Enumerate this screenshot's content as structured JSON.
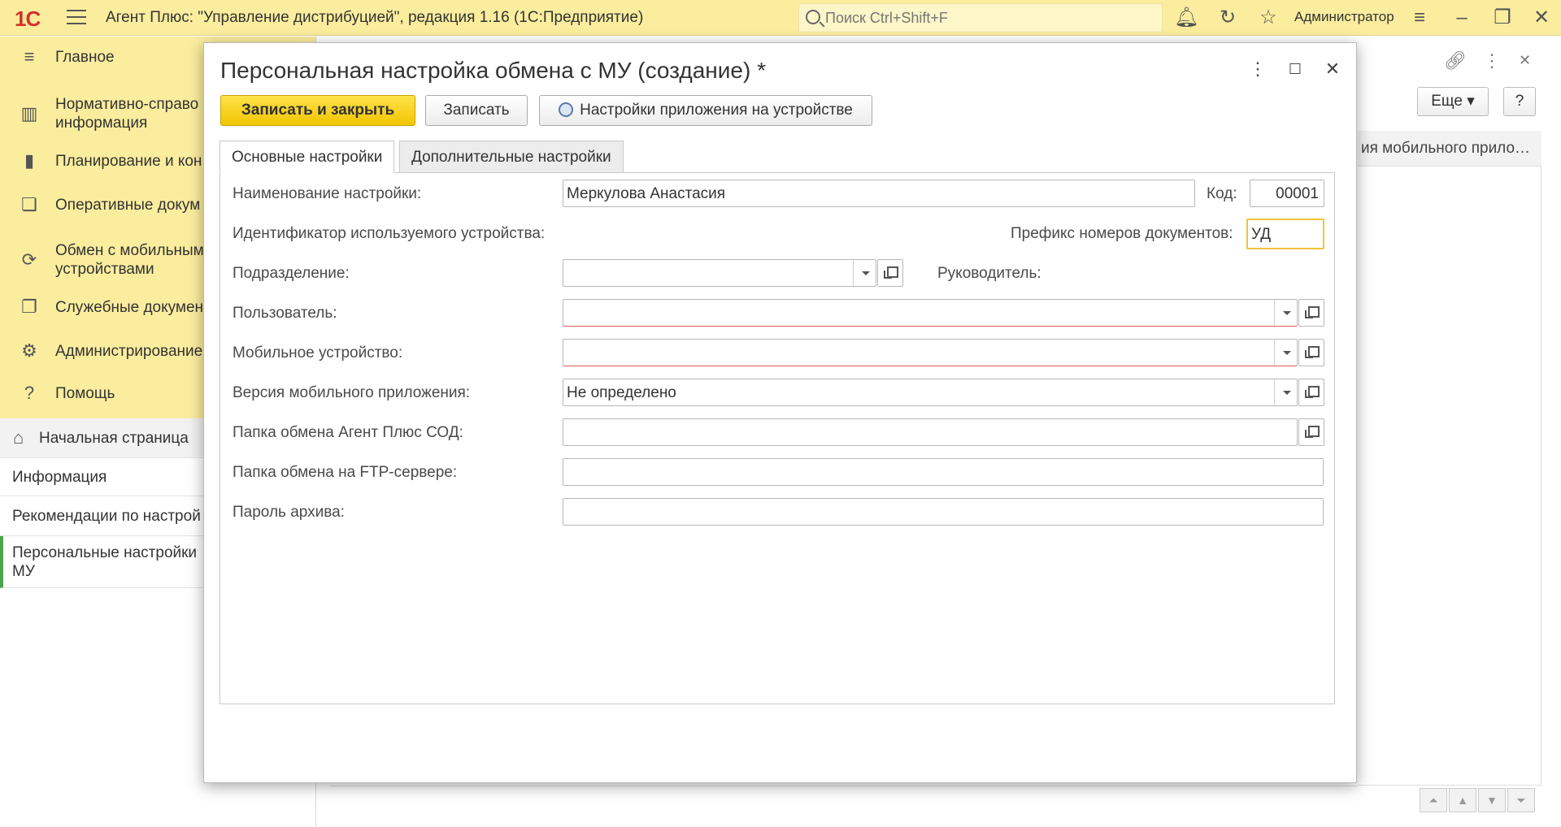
{
  "topbar": {
    "logo": "1С",
    "app_title": "Агент Плюс: \"Управление дистрибуцией\", редакция 1.16  (1С:Предприятие)",
    "search_placeholder": "Поиск Ctrl+Shift+F",
    "user": "Администратор"
  },
  "sidebar": {
    "items": [
      {
        "label": "Главное",
        "icon": "menu-lines-icon"
      },
      {
        "label": "Нормативно-справочная информация",
        "label_line1": "Нормативно-справо",
        "label_line2": "информация",
        "icon": "reference-icon"
      },
      {
        "label": "Планирование и контроль",
        "label_line1": "Планирование и кон",
        "icon": "bar-chart-icon"
      },
      {
        "label": "Оперативные документы",
        "label_line1": "Оперативные докум",
        "icon": "documents-icon"
      },
      {
        "label": "Обмен с мобильными устройствами",
        "label_line1": "Обмен с мобильным",
        "label_line2": "устройствами",
        "icon": "sync-icon"
      },
      {
        "label": "Служебные документы",
        "label_line1": "Служебные докумен",
        "icon": "service-docs-icon"
      },
      {
        "label": "Администрирование",
        "label_line1": "Администрирование",
        "icon": "gear-icon"
      },
      {
        "label": "Помощь",
        "icon": "question-icon"
      }
    ]
  },
  "lower_nav": {
    "items": [
      {
        "label": "Начальная страница",
        "icon": "home-icon"
      },
      {
        "label": "Информация"
      },
      {
        "label": "Рекомендации по настройке",
        "label_line1": "Рекомендации по настрой"
      },
      {
        "label_line1": "Персональные настройки",
        "label_line2": "МУ"
      }
    ]
  },
  "background": {
    "more_label": "Еще",
    "help_label": "?",
    "column_header": "ия мобильного прило…"
  },
  "modal": {
    "title": "Персональная настройка обмена с МУ (создание) *",
    "buttons": {
      "save_close": "Записать и закрыть",
      "save": "Записать",
      "app_settings": "Настройки приложения на устройстве"
    },
    "tabs": [
      "Основные настройки",
      "Дополнительные настройки"
    ],
    "fields": {
      "name_label": "Наименование настройки:",
      "name_value": "Меркулова Анастасия",
      "code_label": "Код:",
      "code_value": "00001",
      "device_id_label": "Идентификатор используемого устройства:",
      "prefix_label": "Префикс номеров документов:",
      "prefix_value": "УД",
      "division_label": "Подразделение:",
      "division_value": "",
      "manager_label": "Руководитель:",
      "user_label": "Пользователь:",
      "user_value": "",
      "mobile_device_label": "Мобильное устройство:",
      "mobile_device_value": "",
      "app_version_label": "Версия мобильного приложения:",
      "app_version_value": "Не определено",
      "folder_label": "Папка обмена Агент Плюс СОД:",
      "folder_value": "",
      "ftp_label": "Папка обмена на FTP-сервере:",
      "ftp_value": "",
      "password_label": "Пароль архива:",
      "password_value": ""
    }
  }
}
